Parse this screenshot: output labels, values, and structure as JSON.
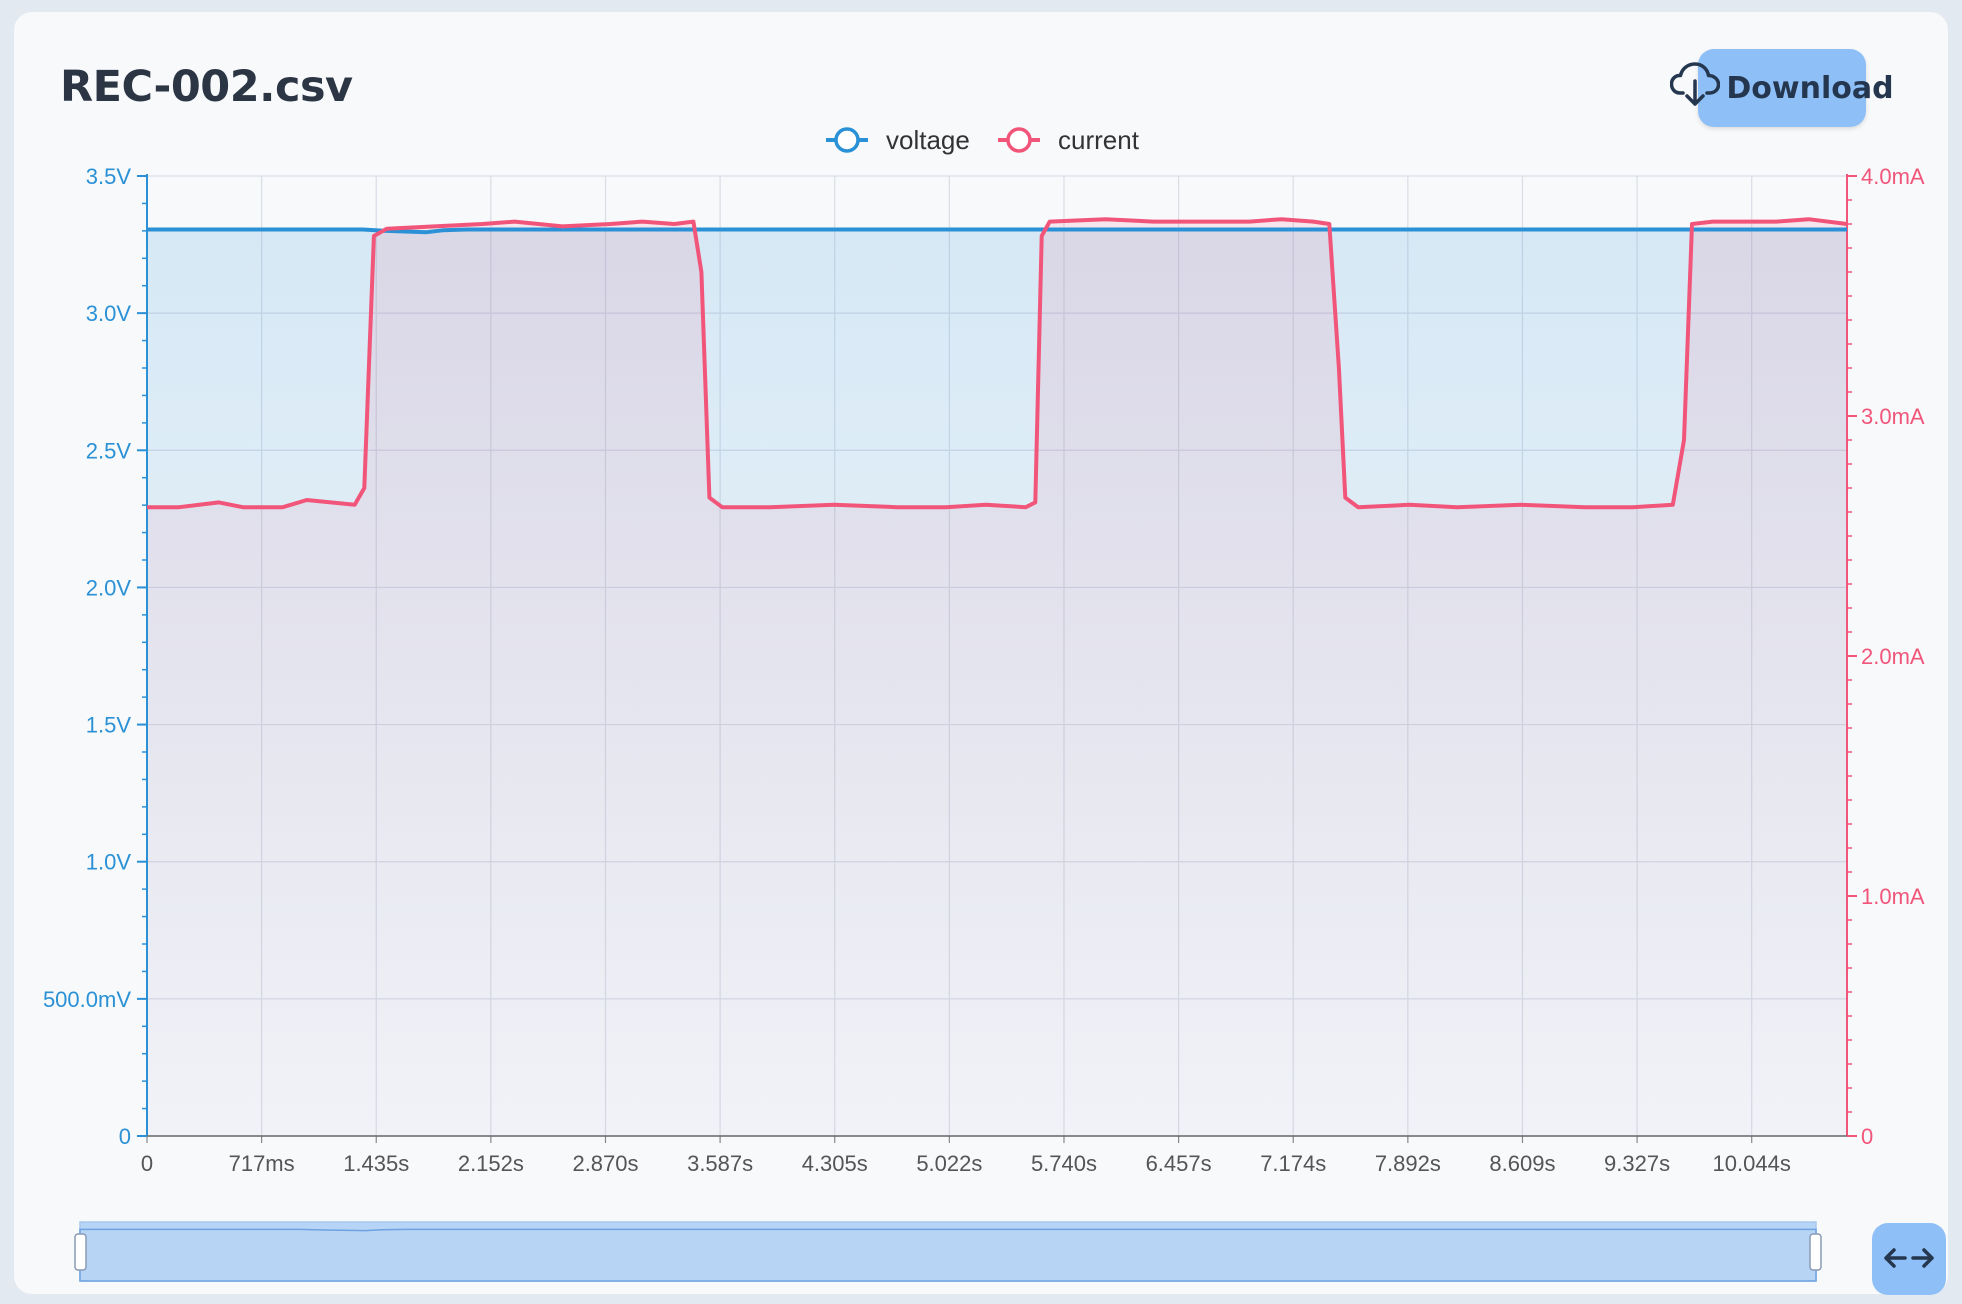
{
  "title": "REC-002.csv",
  "download_label": "Download",
  "icons": {
    "download": "cloud-download-icon",
    "pan": "left-right-arrows-icon"
  },
  "colors": {
    "voltage": "#2b91d6",
    "current": "#f2557a",
    "button": "#8ec0f7"
  },
  "chart_data": {
    "type": "line",
    "title": "",
    "xlabel": "",
    "x_ticks": [
      "0",
      "717ms",
      "1.435s",
      "2.152s",
      "2.870s",
      "3.587s",
      "4.305s",
      "5.022s",
      "5.740s",
      "6.457s",
      "7.174s",
      "7.892s",
      "8.609s",
      "9.327s",
      "10.044s"
    ],
    "xlim": [
      0,
      10.64
    ],
    "legend": "top-center",
    "grid": true,
    "y_left": {
      "label": "",
      "unit": "V",
      "ylim": [
        0,
        3.5
      ],
      "ticks": [
        "0",
        "500.0mV",
        "1.0V",
        "1.5V",
        "2.0V",
        "2.5V",
        "3.0V",
        "3.5V"
      ]
    },
    "y_right": {
      "label": "",
      "unit": "mA",
      "ylim": [
        0,
        4.0
      ],
      "ticks": [
        "0",
        "1.0mA",
        "2.0mA",
        "3.0mA",
        "4.0mA"
      ]
    },
    "series": [
      {
        "name": "voltage",
        "axis": "left",
        "points": [
          [
            0,
            3.305
          ],
          [
            1.35,
            3.305
          ],
          [
            1.5,
            3.3
          ],
          [
            1.75,
            3.295
          ],
          [
            1.85,
            3.302
          ],
          [
            2.0,
            3.305
          ],
          [
            10.64,
            3.305
          ]
        ]
      },
      {
        "name": "current",
        "axis": "right",
        "points": [
          [
            0,
            2.62
          ],
          [
            0.2,
            2.62
          ],
          [
            0.45,
            2.64
          ],
          [
            0.6,
            2.62
          ],
          [
            0.85,
            2.62
          ],
          [
            1.0,
            2.65
          ],
          [
            1.15,
            2.64
          ],
          [
            1.3,
            2.63
          ],
          [
            1.36,
            2.7
          ],
          [
            1.42,
            3.75
          ],
          [
            1.5,
            3.78
          ],
          [
            1.8,
            3.79
          ],
          [
            2.1,
            3.8
          ],
          [
            2.3,
            3.81
          ],
          [
            2.6,
            3.79
          ],
          [
            2.9,
            3.8
          ],
          [
            3.1,
            3.81
          ],
          [
            3.3,
            3.8
          ],
          [
            3.42,
            3.81
          ],
          [
            3.47,
            3.6
          ],
          [
            3.52,
            2.66
          ],
          [
            3.6,
            2.62
          ],
          [
            3.9,
            2.62
          ],
          [
            4.3,
            2.63
          ],
          [
            4.7,
            2.62
          ],
          [
            5.0,
            2.62
          ],
          [
            5.25,
            2.63
          ],
          [
            5.5,
            2.62
          ],
          [
            5.56,
            2.64
          ],
          [
            5.6,
            3.75
          ],
          [
            5.65,
            3.81
          ],
          [
            6.0,
            3.82
          ],
          [
            6.3,
            3.81
          ],
          [
            6.6,
            3.81
          ],
          [
            6.9,
            3.81
          ],
          [
            7.1,
            3.82
          ],
          [
            7.3,
            3.81
          ],
          [
            7.4,
            3.8
          ],
          [
            7.46,
            3.2
          ],
          [
            7.5,
            2.66
          ],
          [
            7.58,
            2.62
          ],
          [
            7.9,
            2.63
          ],
          [
            8.2,
            2.62
          ],
          [
            8.6,
            2.63
          ],
          [
            9.0,
            2.62
          ],
          [
            9.3,
            2.62
          ],
          [
            9.55,
            2.63
          ],
          [
            9.62,
            2.9
          ],
          [
            9.67,
            3.8
          ],
          [
            9.8,
            3.81
          ],
          [
            10.0,
            3.81
          ],
          [
            10.2,
            3.81
          ],
          [
            10.4,
            3.82
          ],
          [
            10.64,
            3.8
          ]
        ]
      }
    ]
  }
}
